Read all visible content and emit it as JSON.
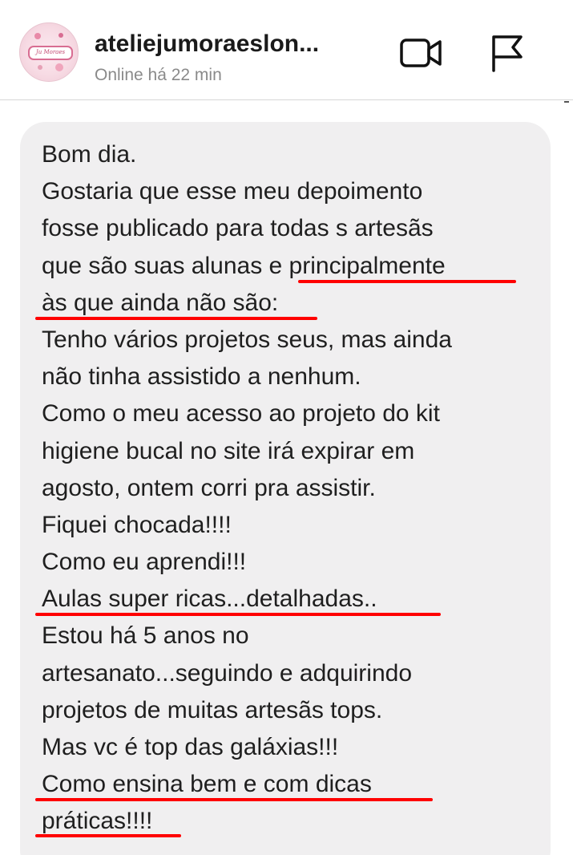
{
  "header": {
    "contact_name": "ateliejumoraeslon...",
    "status": "Online há 22 min",
    "avatar_text": "Ju Moraes",
    "video_icon": "video-call-icon",
    "flag_icon": "report-flag-icon"
  },
  "message": {
    "lines": [
      "Bom dia.",
      "Gostaria que esse meu depoimento",
      "fosse publicado para todas s artesãs",
      "que são suas alunas e principalmente",
      "às que ainda não são:",
      "Tenho vários projetos seus, mas ainda",
      "não tinha assistido a nenhum.",
      "Como o meu acesso ao  projeto do kit",
      "higiene bucal no site irá expirar em",
      "agosto, ontem corri pra assistir.",
      "Fiquei chocada!!!!",
      "Como eu aprendi!!!",
      "Aulas super ricas...detalhadas..",
      "Estou há 5 anos no",
      "artesanato...seguindo e adquirindo",
      "projetos  de muitas artesãs tops.",
      "Mas vc é top das galáxias!!!",
      "Como ensina bem e com dicas",
      "práticas!!!!"
    ]
  },
  "colors": {
    "underline": "#ff0000",
    "bubble": "#f0eff0",
    "text": "#1f1f1f",
    "status": "#8a8a8a"
  }
}
